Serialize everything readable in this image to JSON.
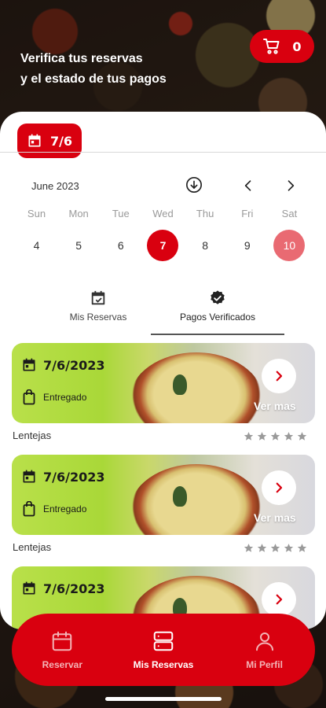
{
  "header": {
    "headline_line1": "Verifica tus reservas",
    "headline_line2": "y el estado de tus pagos",
    "cart_count": "0"
  },
  "date_chip": {
    "label": "7/6"
  },
  "calendar": {
    "month_label": "June 2023",
    "weekdays": [
      "Sun",
      "Mon",
      "Tue",
      "Wed",
      "Thu",
      "Fri",
      "Sat"
    ],
    "days": [
      "4",
      "5",
      "6",
      "7",
      "8",
      "9",
      "10"
    ],
    "selected_day": "7",
    "marked_day": "10"
  },
  "tabs": [
    {
      "label": "Mis Reservas",
      "icon": "calendar-check-icon",
      "active": false
    },
    {
      "label": "Pagos Verificados",
      "icon": "verified-badge-icon",
      "active": true
    }
  ],
  "reservations": [
    {
      "date": "7/6/2023",
      "status": "Entregado",
      "action": "Ver mas",
      "dish": "Lentejas",
      "rating": 0,
      "max_rating": 5
    },
    {
      "date": "7/6/2023",
      "status": "Entregado",
      "action": "Ver mas",
      "dish": "Lentejas",
      "rating": 0,
      "max_rating": 5
    },
    {
      "date": "7/6/2023",
      "status": "",
      "action": "",
      "dish": "",
      "rating": 0,
      "max_rating": 5
    }
  ],
  "bottom_nav": [
    {
      "label": "Reservar",
      "icon": "calendar-icon",
      "active": false
    },
    {
      "label": "Mis Reservas",
      "icon": "server-stack-icon",
      "active": true
    },
    {
      "label": "Mi Perfil",
      "icon": "user-icon",
      "active": false
    }
  ],
  "colors": {
    "primary": "#d9000f",
    "marked_day": "#e96a72",
    "nav_inactive": "#f3b3b6"
  }
}
